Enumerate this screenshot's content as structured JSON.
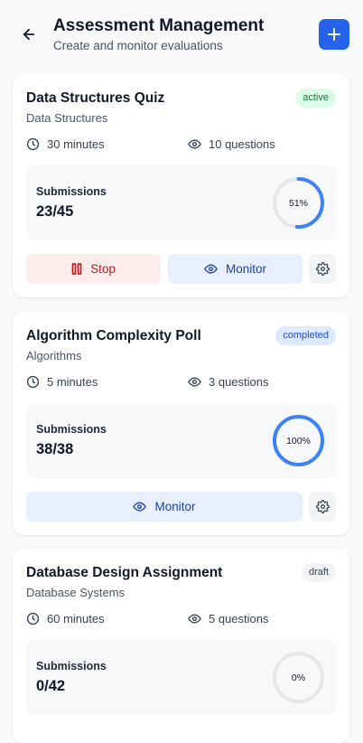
{
  "header": {
    "title": "Assessment Management",
    "subtitle": "Create and monitor evaluations",
    "back_icon": "arrow-left-icon",
    "add_icon": "plus-icon",
    "accent": "#2563eb"
  },
  "cards": [
    {
      "title": "Data Structures Quiz",
      "subject": "Data Structures",
      "status": "active",
      "duration": "30 minutes",
      "questions": "10 questions",
      "submissions_label": "Submissions",
      "submissions": "23/45",
      "progress": 0.51,
      "progress_label": "51%",
      "actions": {
        "stop": "Stop",
        "monitor": "Monitor"
      }
    },
    {
      "title": "Algorithm Complexity Poll",
      "subject": "Algorithms",
      "status": "completed",
      "duration": "5 minutes",
      "questions": "3 questions",
      "submissions_label": "Submissions",
      "submissions": "38/38",
      "progress": 1.0,
      "progress_label": "100%",
      "actions": {
        "monitor": "Monitor"
      }
    },
    {
      "title": "Database Design Assignment",
      "subject": "Database Systems",
      "status": "draft",
      "duration": "60 minutes",
      "questions": "5 questions",
      "submissions_label": "Submissions",
      "submissions": "0/42",
      "progress": 0,
      "progress_label": "0%"
    }
  ],
  "colors": {
    "ring_fill": "#3b82f6",
    "ring_track": "#e5e7eb",
    "active_bg": "#dcfce7",
    "completed_bg": "#dbeafe",
    "draft_bg": "#f3f4f6"
  }
}
